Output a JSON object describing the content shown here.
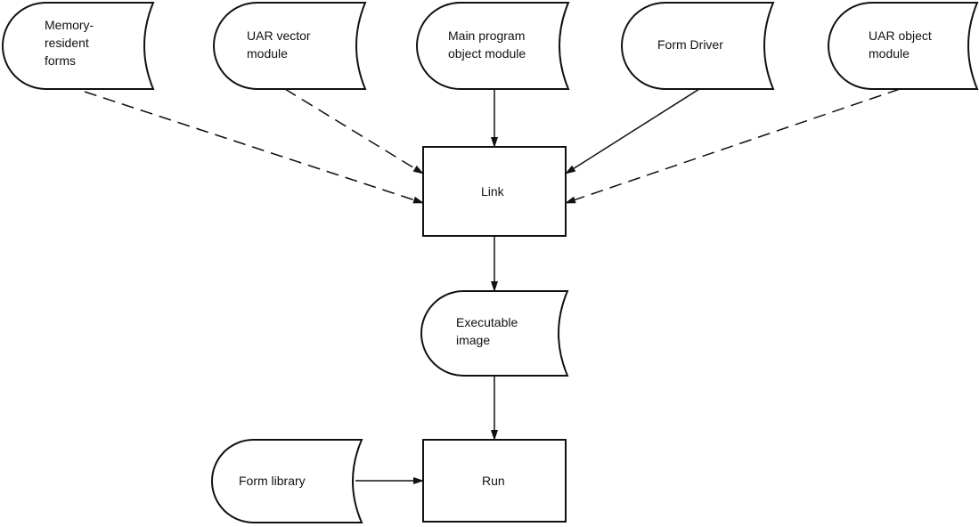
{
  "nodes": {
    "memory_resident_forms": {
      "lines": [
        "Memory-",
        "resident",
        "forms"
      ],
      "shape": "stored-data"
    },
    "uar_vector_module": {
      "lines": [
        "UAR vector",
        "module"
      ],
      "shape": "stored-data"
    },
    "main_program_object_module": {
      "lines": [
        "Main program",
        "object module"
      ],
      "shape": "stored-data"
    },
    "form_driver": {
      "lines": [
        "Form Driver"
      ],
      "shape": "stored-data"
    },
    "uar_object_module": {
      "lines": [
        "UAR object",
        "module"
      ],
      "shape": "stored-data"
    },
    "link": {
      "lines": [
        "Link"
      ],
      "shape": "process"
    },
    "executable_image": {
      "lines": [
        "Executable",
        "image"
      ],
      "shape": "stored-data"
    },
    "form_library": {
      "lines": [
        "Form library"
      ],
      "shape": "stored-data"
    },
    "run": {
      "lines": [
        "Run"
      ],
      "shape": "process"
    }
  },
  "edges": [
    {
      "from": "memory_resident_forms",
      "to": "link",
      "style": "dashed"
    },
    {
      "from": "uar_vector_module",
      "to": "link",
      "style": "dashed"
    },
    {
      "from": "main_program_object_module",
      "to": "link",
      "style": "solid"
    },
    {
      "from": "form_driver",
      "to": "link",
      "style": "solid"
    },
    {
      "from": "uar_object_module",
      "to": "link",
      "style": "dashed"
    },
    {
      "from": "link",
      "to": "executable_image",
      "style": "solid"
    },
    {
      "from": "executable_image",
      "to": "run",
      "style": "solid"
    },
    {
      "from": "form_library",
      "to": "run",
      "style": "solid"
    }
  ],
  "colors": {
    "stroke": "#111111",
    "background": "#ffffff"
  }
}
